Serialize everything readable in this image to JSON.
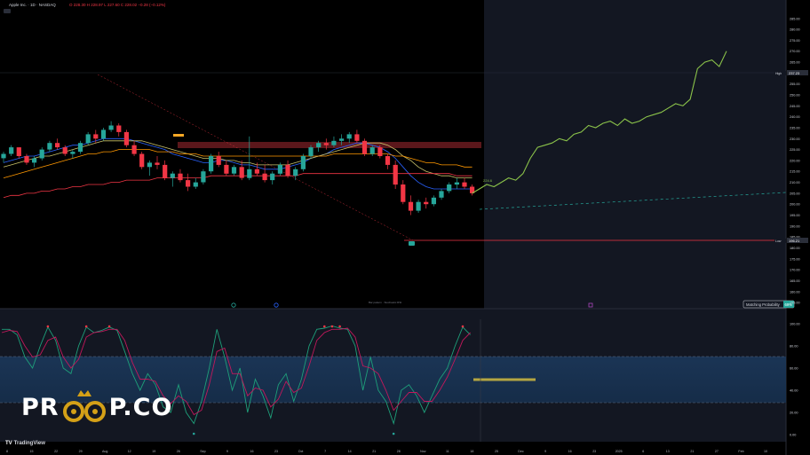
{
  "header": {
    "symbol": "Apple Inc. · 1D · NASDAQ",
    "ohlc": "O 228.30  H 228.97  L 227.60  C 228.02  −0.28 (−0.12%)"
  },
  "price_axis": {
    "ticks": [
      "290.00",
      "285.00",
      "280.00",
      "275.00",
      "270.00",
      "265.00",
      "260.00",
      "255.00",
      "250.00",
      "245.00",
      "240.00",
      "235.00",
      "230.00",
      "225.00",
      "220.00",
      "215.00",
      "210.00",
      "205.00",
      "200.00",
      "195.00",
      "190.00",
      "185.00",
      "180.00",
      "175.00",
      "170.00",
      "165.00",
      "160.00",
      "155.00"
    ],
    "high_label": "High",
    "high_value": "237.23",
    "low_label": "Low",
    "low_value": "196.21"
  },
  "osc_axis": {
    "ticks": [
      "100.00",
      "80.00",
      "60.00",
      "40.00",
      "20.00",
      "0.00"
    ]
  },
  "time_axis": {
    "labels": [
      "8",
      "15",
      "22",
      "29",
      "Aug",
      "12",
      "19",
      "26",
      "Sep",
      "9",
      "16",
      "23",
      "Oct",
      "7",
      "14",
      "21",
      "28",
      "Nov",
      "11",
      "18",
      "25",
      "Dec",
      "9",
      "16",
      "23",
      "2025",
      "6",
      "13",
      "21",
      "27",
      "Feb",
      "10"
    ]
  },
  "annotations": {
    "matching_label": "Matching Probability",
    "matching_value": "69%",
    "projection_value": "224.6",
    "credit": "Bar pattern · Stochastic RSI"
  },
  "brand": {
    "logo_text_1": "PR",
    "logo_text_2": "P.CO",
    "tv_logo": "TradingView"
  },
  "colors": {
    "up": "#26a69a",
    "down": "#f23645",
    "projection": "#8bc34a",
    "k_line": "#1e9f7a",
    "d_line": "#c2185b"
  },
  "chart_data": [
    {
      "type": "candlestick",
      "title": "",
      "ylim": [
        153,
        291
      ],
      "ohlc": [
        [
          221,
          224,
          219,
          223
        ],
        [
          223,
          227,
          222,
          226
        ],
        [
          226,
          226,
          221,
          222
        ],
        [
          222,
          223,
          218,
          219
        ],
        [
          219,
          222,
          217,
          221
        ],
        [
          221,
          226,
          220,
          225
        ],
        [
          225,
          229,
          224,
          228
        ],
        [
          228,
          230,
          225,
          226
        ],
        [
          226,
          227,
          222,
          223
        ],
        [
          223,
          225,
          221,
          224
        ],
        [
          224,
          229,
          223,
          228
        ],
        [
          228,
          233,
          227,
          232
        ],
        [
          232,
          234,
          228,
          230
        ],
        [
          230,
          235,
          229,
          234
        ],
        [
          234,
          238,
          233,
          236
        ],
        [
          236,
          237,
          231,
          233
        ],
        [
          233,
          234,
          226,
          227
        ],
        [
          227,
          229,
          222,
          223
        ],
        [
          223,
          224,
          216,
          217
        ],
        [
          217,
          220,
          213,
          219
        ],
        [
          219,
          222,
          216,
          218
        ],
        [
          218,
          220,
          211,
          212
        ],
        [
          212,
          215,
          208,
          214
        ],
        [
          214,
          216,
          210,
          211
        ],
        [
          211,
          214,
          206,
          208
        ],
        [
          208,
          212,
          207,
          210
        ],
        [
          210,
          216,
          209,
          215
        ],
        [
          215,
          223,
          214,
          222
        ],
        [
          222,
          224,
          217,
          218
        ],
        [
          218,
          220,
          213,
          214
        ],
        [
          214,
          218,
          213,
          217
        ],
        [
          217,
          220,
          211,
          212
        ],
        [
          212,
          231,
          211,
          216
        ],
        [
          216,
          219,
          213,
          214
        ],
        [
          214,
          218,
          210,
          211
        ],
        [
          211,
          215,
          209,
          214
        ],
        [
          214,
          219,
          213,
          218
        ],
        [
          218,
          220,
          212,
          213
        ],
        [
          213,
          217,
          211,
          216
        ],
        [
          216,
          223,
          215,
          222
        ],
        [
          222,
          227,
          221,
          226
        ],
        [
          226,
          229,
          224,
          228
        ],
        [
          228,
          230,
          225,
          227
        ],
        [
          227,
          231,
          226,
          229
        ],
        [
          229,
          232,
          227,
          230
        ],
        [
          230,
          233,
          228,
          232
        ],
        [
          232,
          234,
          228,
          229
        ],
        [
          229,
          230,
          222,
          223
        ],
        [
          223,
          227,
          222,
          226
        ],
        [
          226,
          227,
          221,
          222
        ],
        [
          222,
          223,
          216,
          218
        ],
        [
          218,
          220,
          207,
          209
        ],
        [
          209,
          211,
          200,
          201
        ],
        [
          201,
          204,
          195,
          197
        ],
        [
          197,
          202,
          196,
          201
        ],
        [
          201,
          203,
          198,
          200
        ],
        [
          200,
          204,
          199,
          203
        ],
        [
          203,
          207,
          202,
          206
        ],
        [
          206,
          210,
          205,
          209
        ],
        [
          209,
          212,
          207,
          210
        ],
        [
          210,
          212,
          207,
          208
        ],
        [
          208,
          209,
          204,
          205
        ]
      ],
      "projection": [
        205,
        207,
        209,
        208,
        210,
        212,
        211,
        214,
        221,
        226,
        227,
        228,
        230,
        229,
        232,
        233,
        236,
        235,
        237,
        238,
        236,
        239,
        237,
        238,
        240,
        241,
        242,
        244,
        246,
        245,
        248,
        262,
        265,
        266,
        263,
        270
      ],
      "series": [
        {
          "name": "",
          "values": [
            219,
            220,
            221,
            222,
            222,
            223,
            224,
            225,
            226,
            227,
            227,
            228,
            229,
            230,
            230,
            230,
            230,
            229,
            228,
            227,
            226,
            225,
            223,
            222,
            221,
            220,
            219,
            219,
            220,
            220,
            219,
            218,
            218,
            217,
            216,
            216,
            216,
            217,
            218,
            219,
            221,
            222,
            223,
            225,
            226,
            227,
            228,
            228,
            227,
            226,
            224,
            221,
            217,
            213,
            210,
            208,
            207,
            207,
            207,
            207,
            207,
            207
          ]
        },
        {
          "name": "",
          "values": [
            217,
            218,
            219,
            220,
            221,
            222,
            222,
            223,
            224,
            225,
            226,
            227,
            228,
            229,
            229,
            229,
            229,
            229,
            229,
            228,
            227,
            226,
            225,
            224,
            223,
            222,
            221,
            221,
            221,
            220,
            220,
            219,
            219,
            218,
            218,
            218,
            218,
            218,
            219,
            220,
            221,
            222,
            223,
            224,
            225,
            226,
            227,
            228,
            228,
            228,
            227,
            225,
            222,
            220,
            217,
            215,
            214,
            213,
            213,
            212,
            212,
            212
          ]
        },
        {
          "name": "",
          "values": [
            212,
            213,
            214,
            215,
            216,
            217,
            218,
            219,
            220,
            221,
            222,
            223,
            223,
            224,
            224,
            225,
            225,
            225,
            225,
            225,
            224,
            224,
            224,
            223,
            223,
            223,
            222,
            222,
            222,
            222,
            222,
            222,
            222,
            222,
            222,
            222,
            222,
            222,
            222,
            222,
            222,
            222,
            222,
            223,
            223,
            223,
            223,
            223,
            223,
            223,
            223,
            222,
            222,
            221,
            220,
            219,
            219,
            218,
            218,
            218,
            217,
            217
          ]
        },
        {
          "name": "",
          "values": [
            203,
            204,
            204,
            205,
            205,
            206,
            206,
            207,
            207,
            208,
            208,
            209,
            209,
            209,
            210,
            210,
            211,
            211,
            211,
            211,
            212,
            212,
            212,
            212,
            212,
            212,
            212,
            213,
            213,
            213,
            213,
            213,
            213,
            213,
            213,
            213,
            213,
            213,
            213,
            214,
            214,
            214,
            214,
            214,
            214,
            214,
            214,
            214,
            214,
            214,
            214,
            214,
            214,
            214,
            214,
            214,
            214,
            214,
            214,
            213,
            213,
            213
          ]
        }
      ]
    },
    {
      "type": "line",
      "title": "",
      "ylim": [
        0,
        100
      ],
      "series": [
        {
          "name": "",
          "values": [
            95,
            95,
            90,
            70,
            60,
            80,
            97,
            85,
            60,
            55,
            80,
            97,
            92,
            94,
            97,
            94,
            75,
            55,
            40,
            55,
            45,
            25,
            20,
            45,
            20,
            10,
            30,
            60,
            95,
            70,
            40,
            60,
            20,
            50,
            35,
            15,
            45,
            55,
            30,
            50,
            80,
            95,
            96,
            98,
            96,
            95,
            80,
            40,
            70,
            40,
            30,
            10,
            40,
            45,
            35,
            20,
            35,
            50,
            60,
            80,
            97,
            90
          ]
        },
        {
          "name": "",
          "values": [
            92,
            94,
            93,
            80,
            70,
            72,
            85,
            88,
            70,
            60,
            68,
            88,
            92,
            93,
            95,
            95,
            85,
            65,
            50,
            50,
            48,
            35,
            28,
            35,
            30,
            18,
            22,
            45,
            75,
            78,
            55,
            55,
            35,
            42,
            40,
            25,
            32,
            48,
            38,
            42,
            62,
            85,
            92,
            95,
            95,
            96,
            88,
            62,
            60,
            55,
            40,
            22,
            30,
            38,
            38,
            30,
            30,
            40,
            52,
            68,
            85,
            92
          ]
        }
      ]
    }
  ]
}
